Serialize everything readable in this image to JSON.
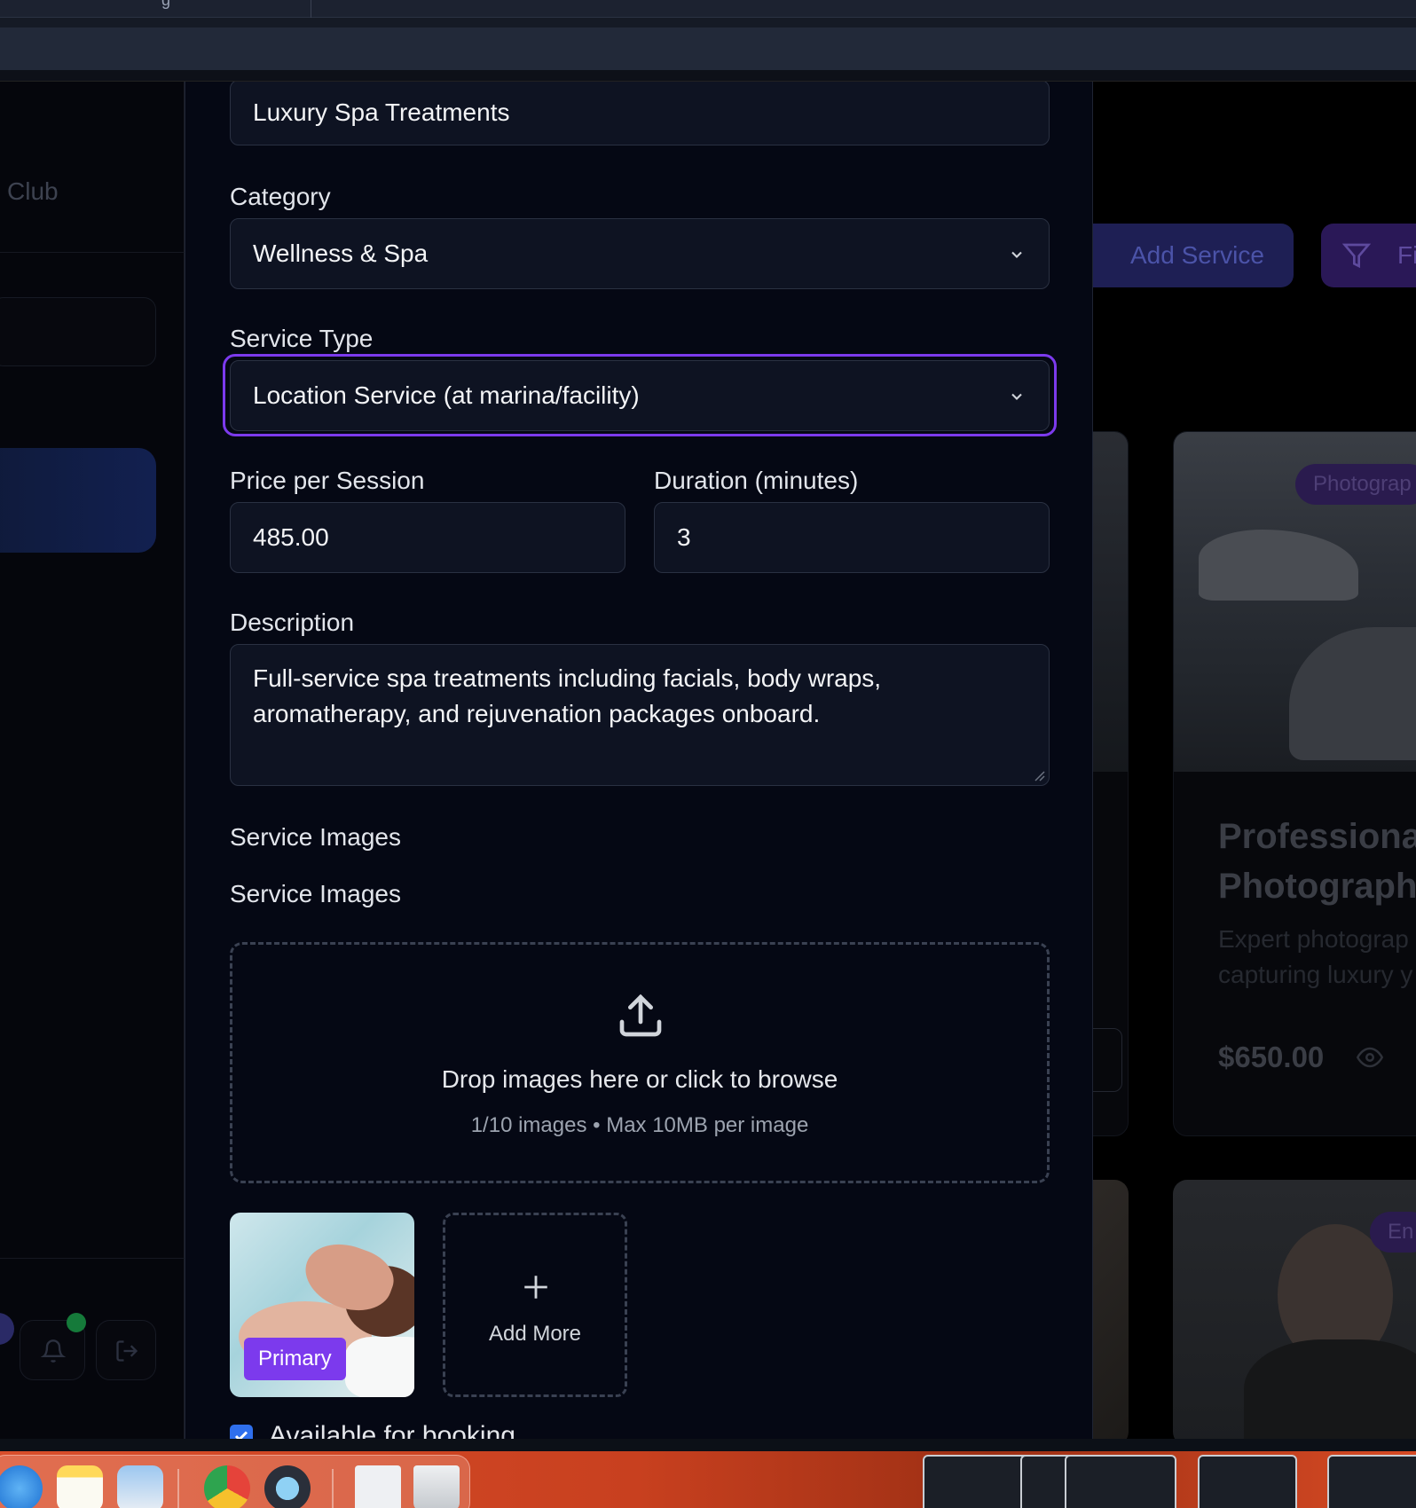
{
  "window": {
    "topbar_glyph": "g"
  },
  "background_app": {
    "sidebar_text": "Club",
    "add_service_label": "Add Service",
    "filter_label": "Fi",
    "card_photo": {
      "tag": "Photograp",
      "title_line1": "Professiona",
      "title_line2": "Photograph",
      "desc_line1": "Expert photograp",
      "desc_line2": "capturing luxury y",
      "price": "$650.00"
    },
    "card_entertainment": {
      "tag": "En"
    }
  },
  "modal": {
    "service_name_value": "Luxury Spa Treatments",
    "category": {
      "label": "Category",
      "value": "Wellness & Spa"
    },
    "service_type": {
      "label": "Service Type",
      "value": "Location Service (at marina/facility)"
    },
    "price": {
      "label": "Price per Session",
      "value": "485.00"
    },
    "duration": {
      "label": "Duration (minutes)",
      "value": "3"
    },
    "description": {
      "label": "Description",
      "value": "Full-service spa treatments including facials, body wraps, aromatherapy, and rejuvenation packages onboard."
    },
    "images": {
      "section_label": "Service Images",
      "field_label": "Service Images",
      "drop_text": "Drop images here or click to browse",
      "count_text": "1/10 images",
      "bullet": "•",
      "limit_text": "Max 10MB per image",
      "primary_badge": "Primary",
      "add_more_label": "Add More"
    },
    "available": {
      "label": "Available for booking",
      "checked": true
    }
  },
  "colors": {
    "accent": "#7c3aed",
    "focus_ring": "#7c3aed",
    "checkbox": "#2f6fed",
    "background": "#050814"
  }
}
